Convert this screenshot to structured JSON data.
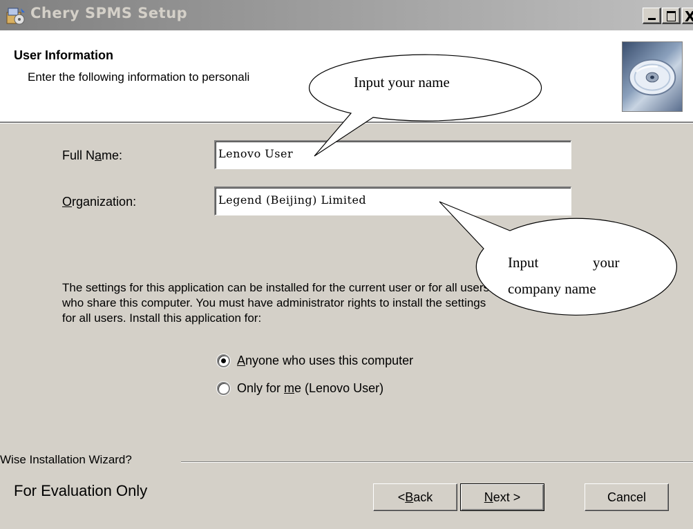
{
  "window": {
    "title": "Chery SPMS Setup",
    "close_glyph": "X"
  },
  "header": {
    "title": "User Information",
    "subtitle": "Enter the following information to personali"
  },
  "form": {
    "full_name": {
      "label_pre": "Full N",
      "label_accel": "a",
      "label_post": "me:",
      "value": "Lenovo User"
    },
    "organization": {
      "label_pre": "",
      "label_accel": "O",
      "label_post": "rganization:",
      "value": "Legend (Beijing) Limited"
    }
  },
  "description": "The settings for this application can be installed for the current user or for all users who share this computer. You must have administrator rights to install the settings for all users. Install this application for:",
  "install_for": {
    "options": [
      {
        "pre": "",
        "accel": "A",
        "post": "nyone who uses this computer",
        "selected": true
      },
      {
        "pre": "Only for ",
        "accel": "m",
        "post": "e (Lenovo User)",
        "selected": false
      }
    ]
  },
  "footer": {
    "wizard_label": "Wise Installation Wizard?",
    "evaluation": "For Evaluation Only"
  },
  "buttons": {
    "back": {
      "pre": "< ",
      "accel": "B",
      "post": "ack"
    },
    "next": {
      "pre": "",
      "accel": "N",
      "post": "ext >"
    },
    "cancel": "Cancel"
  },
  "callouts": {
    "name_hint": "Input your name",
    "company_hint_line1_a": "Input",
    "company_hint_line1_b": "your",
    "company_hint_line2": "company name"
  },
  "icons": {
    "app": "installer-icon",
    "header_image": "cd-disc-icon"
  }
}
